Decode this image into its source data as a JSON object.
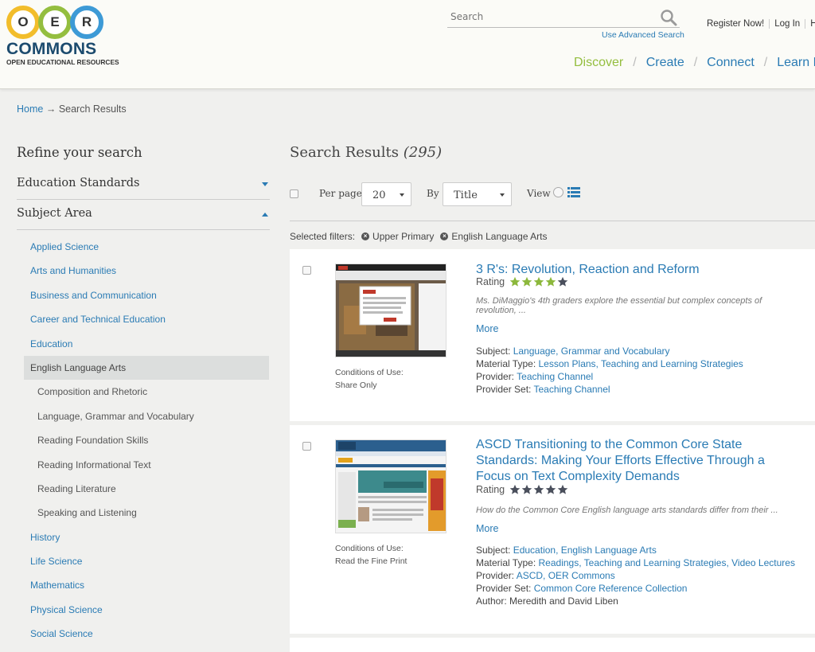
{
  "logo": {
    "letters": [
      "O",
      "E",
      "R"
    ],
    "name": "COMMONS",
    "tagline": "OPEN EDUCATIONAL RESOURCES"
  },
  "search": {
    "placeholder": "Search",
    "advanced_label": "Use Advanced Search"
  },
  "top_links": [
    "Register Now!",
    "Log In",
    "He"
  ],
  "nav": [
    {
      "label": "Discover",
      "active": true
    },
    {
      "label": "Create",
      "active": false
    },
    {
      "label": "Connect",
      "active": false
    },
    {
      "label": "Learn Mor",
      "active": false
    }
  ],
  "breadcrumb": {
    "home": "Home",
    "arrow": "→",
    "current": "Search Results"
  },
  "sidebar": {
    "title": "Refine your search",
    "facets": [
      {
        "label": "Education Standards",
        "expanded": false
      },
      {
        "label": "Subject Area",
        "expanded": true
      }
    ],
    "subjects": [
      {
        "label": "Applied Science",
        "level": 0,
        "selected": false
      },
      {
        "label": "Arts and Humanities",
        "level": 0,
        "selected": false
      },
      {
        "label": "Business and Communication",
        "level": 0,
        "selected": false
      },
      {
        "label": "Career and Technical Education",
        "level": 0,
        "selected": false
      },
      {
        "label": "Education",
        "level": 0,
        "selected": false
      },
      {
        "label": "English Language Arts",
        "level": 0,
        "selected": true
      },
      {
        "label": "Composition and Rhetoric",
        "level": 1,
        "selected": false
      },
      {
        "label": "Language, Grammar and Vocabulary",
        "level": 1,
        "selected": false
      },
      {
        "label": "Reading Foundation Skills",
        "level": 1,
        "selected": false
      },
      {
        "label": "Reading Informational Text",
        "level": 1,
        "selected": false
      },
      {
        "label": "Reading Literature",
        "level": 1,
        "selected": false
      },
      {
        "label": "Speaking and Listening",
        "level": 1,
        "selected": false
      },
      {
        "label": "History",
        "level": 0,
        "selected": false
      },
      {
        "label": "Life Science",
        "level": 0,
        "selected": false
      },
      {
        "label": "Mathematics",
        "level": 0,
        "selected": false
      },
      {
        "label": "Physical Science",
        "level": 0,
        "selected": false
      },
      {
        "label": "Social Science",
        "level": 0,
        "selected": false
      }
    ]
  },
  "results": {
    "title": "Search Results",
    "count": "(295)",
    "per_page_label": "Per page",
    "per_page_value": "20",
    "sort_label": "By",
    "sort_value": "Title",
    "view_label": "View",
    "selected_filters_label": "Selected filters:",
    "selected_filters": [
      "Upper Primary",
      "English Language Arts"
    ],
    "items": [
      {
        "title": "3 R's: Revolution, Reaction and Reform",
        "rating_label": "Rating",
        "stars_filled": 4,
        "description": "Ms. DiMaggio's 4th graders explore the essential but complex concepts of revolution, ...",
        "more": "More",
        "conditions_label": "Conditions of Use:",
        "conditions_value": "Share Only",
        "meta": [
          {
            "key": "Subject:",
            "value": "Language, Grammar and Vocabulary"
          },
          {
            "key": "Material Type:",
            "value": "Lesson Plans, Teaching and Learning Strategies"
          },
          {
            "key": "Provider:",
            "value": "Teaching Channel"
          },
          {
            "key": "Provider Set:",
            "value": "Teaching Channel"
          }
        ]
      },
      {
        "title": "ASCD Transitioning to the Common Core State Standards: Making Your Efforts Effective Through a Focus on Text Complexity Demands",
        "rating_label": "Rating",
        "stars_filled": 0,
        "description": "How do the Common Core English language arts standards differ from their ...",
        "more": "More",
        "conditions_label": "Conditions of Use:",
        "conditions_value": "Read the Fine Print",
        "meta": [
          {
            "key": "Subject:",
            "value": "Education, English Language Arts"
          },
          {
            "key": "Material Type:",
            "value": "Readings, Teaching and Learning Strategies, Video Lectures"
          },
          {
            "key": "Provider:",
            "value": "ASCD, OER Commons"
          },
          {
            "key": "Provider Set:",
            "value": "Common Core Reference Collection"
          },
          {
            "key": "Author:",
            "value": "Meredith and David Liben",
            "plain": true
          }
        ]
      }
    ]
  },
  "colors": {
    "link": "#2a7bb4",
    "accent_green": "#94be3f",
    "star_filled": "#8cb83c",
    "star_empty": "#4a4f5c",
    "logo_o": "#f2bd2b",
    "logo_e": "#94be3f",
    "logo_r": "#3d9ad6"
  }
}
